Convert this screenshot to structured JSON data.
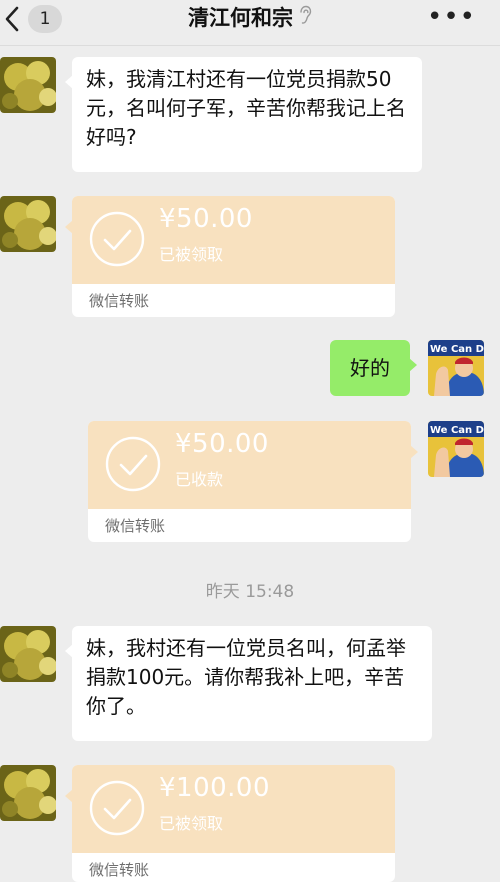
{
  "header": {
    "unread_count": "1",
    "title": "清江何和宗"
  },
  "messages": {
    "m1": {
      "text": "妹，我清江村还有一位党员捐款50元，名叫何子军，辛苦你帮我记上名好吗?"
    },
    "t1": {
      "amount": "¥50.00",
      "status": "已被领取",
      "label": "微信转账"
    },
    "m2": {
      "text": "好的"
    },
    "t2": {
      "amount": "¥50.00",
      "status": "已收款",
      "label": "微信转账"
    },
    "timestamp": "昨天 15:48",
    "m3": {
      "text": "妹，我村还有一位党员名叫，何孟举捐款100元。请你帮我补上吧，辛苦你了。"
    },
    "t3": {
      "amount": "¥100.00",
      "status": "已被领取",
      "label": "微信转账"
    }
  },
  "avatars": {
    "mine_poster_text": "We Can Do It!"
  },
  "colors": {
    "background": "#ededed",
    "my_bubble": "#95ec69",
    "transfer_top": "#f8e1bf",
    "timestamp": "#9a9a9a"
  },
  "icons": {
    "back": "chevron-left-icon",
    "mute": "ear-icon",
    "more": "more-icon",
    "transfer_status": "check-circle-icon"
  }
}
